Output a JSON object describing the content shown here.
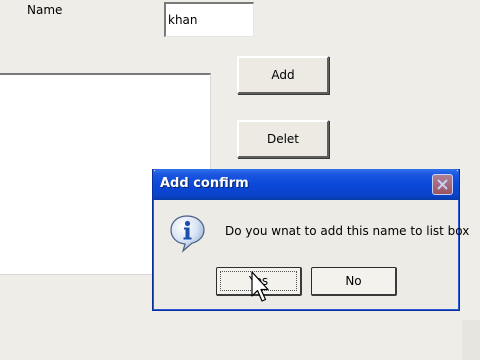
{
  "form": {
    "name_label": "Name",
    "name_value": "khan",
    "add_label": "Add",
    "delete_label": "Delet"
  },
  "dialog": {
    "title": "Add confirm",
    "message": "Do you wnat to add this name to list box",
    "yes_label": "Yes",
    "no_label": "No",
    "icon": "info-icon",
    "colors": {
      "titlebar": "#0a46d8",
      "title_text": "#ffffff"
    }
  }
}
